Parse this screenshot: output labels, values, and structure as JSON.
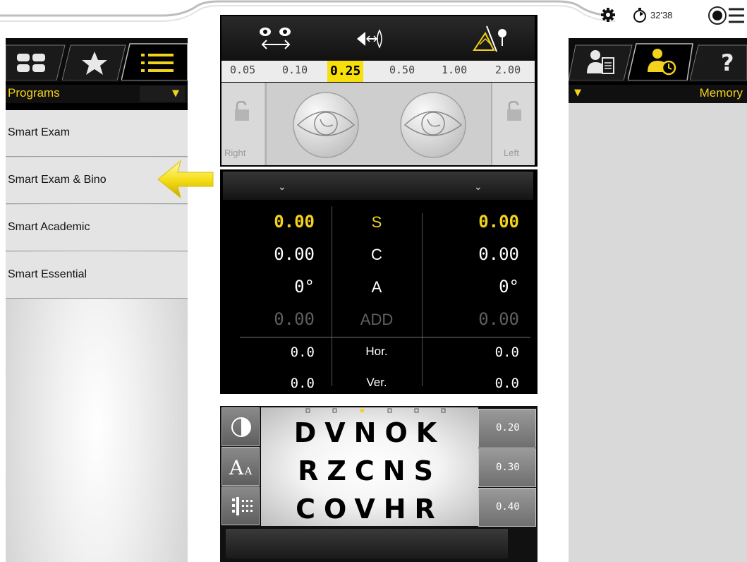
{
  "topbar": {
    "timer": "32'38",
    "icons": [
      "gear-icon",
      "timer-icon",
      "menu-icon"
    ]
  },
  "left_panel": {
    "tabs": [
      "grid-view-icon",
      "favorites-star-icon",
      "list-view-icon"
    ],
    "header": "Programs",
    "dropdown_arrow": "▼",
    "programs": [
      "Smart Exam",
      "Smart Exam & Bino",
      "Smart Academic",
      "Smart Essential"
    ],
    "pointer_icon": "yellow-arrow-icon"
  },
  "distance": {
    "icons": [
      "eyes-distance-icon",
      "vertex-icon",
      "fog-icon"
    ],
    "values": [
      "0.05",
      "0.10",
      "0.25",
      "0.50",
      "1.00",
      "2.00"
    ],
    "selected": "0.25",
    "right_label": "Right",
    "left_label": "Left"
  },
  "refraction": {
    "rows": [
      {
        "label": "S",
        "right": "0.00",
        "left": "0.00",
        "highlight": true
      },
      {
        "label": "C",
        "right": "0.00",
        "left": "0.00"
      },
      {
        "label": "A",
        "right": "0°",
        "left": "0°"
      },
      {
        "label": "ADD",
        "right": "0.00",
        "left": "0.00",
        "dim": true
      },
      {
        "label": "Hor.",
        "right": "0.0",
        "left": "0.0"
      },
      {
        "label": "Ver.",
        "right": "0.0",
        "left": "0.0"
      }
    ]
  },
  "acuity": {
    "rows": [
      {
        "letters": "DVNOK",
        "value": "0.20"
      },
      {
        "letters": "RZCNS",
        "value": "0.30"
      },
      {
        "letters": "COVHR",
        "value": "0.40"
      }
    ],
    "side_icons": [
      "contrast-icon",
      "font-size-icon",
      "pattern-icon"
    ]
  },
  "right_panel": {
    "tabs": [
      "patient-record-icon",
      "patient-history-icon",
      "help-icon"
    ],
    "header": "Memory",
    "dropdown_arrow": "▼"
  },
  "colors": {
    "accent": "#f2d21a",
    "panel_bg": "#000000"
  }
}
